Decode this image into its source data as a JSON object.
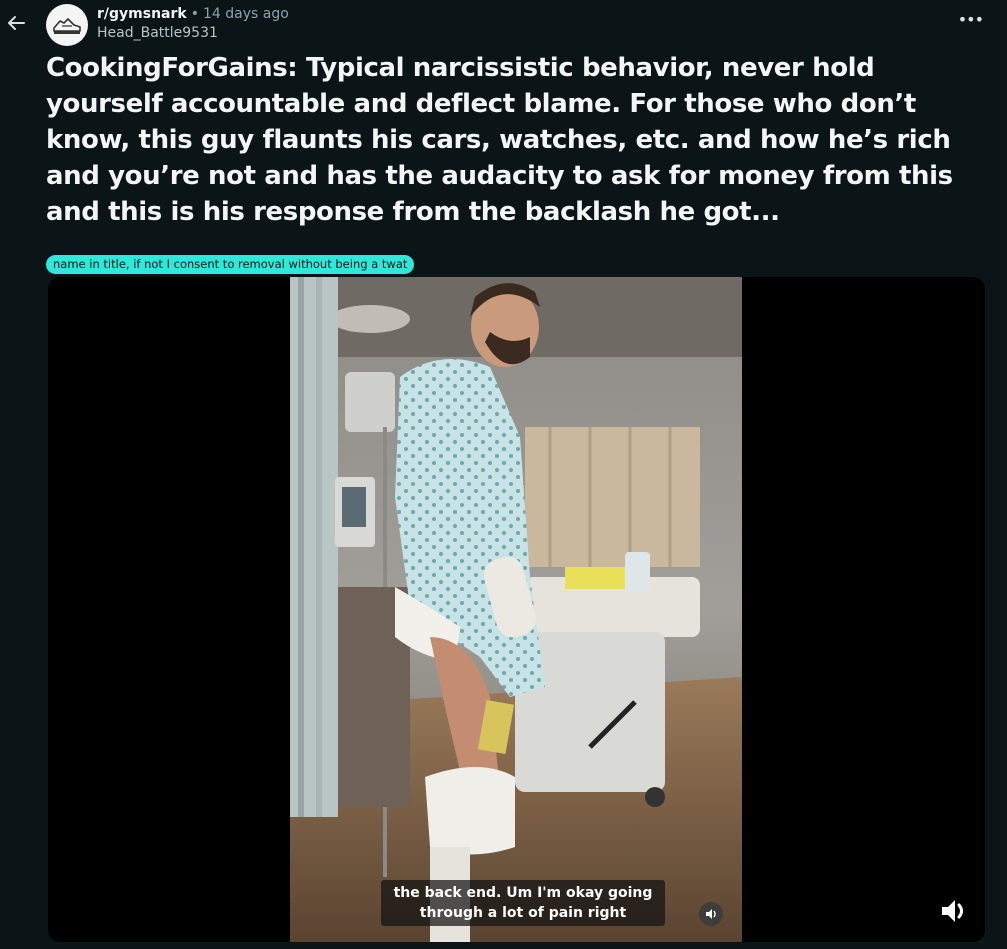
{
  "header": {
    "subreddit": "r/gymsnark",
    "separator": "•",
    "age": "14 days ago",
    "username": "Head_Battle9531",
    "more_label": "•••"
  },
  "post": {
    "title": "CookingForGains: Typical narcissistic behavior, never hold yourself accountable and deflect blame. For those who don’t know, this guy flaunts his cars, watches, etc. and how he’s rich and you’re not and has the audacity to ask for money from this and this is his response from the backlash he got...",
    "flair": "name in title, if not I consent to removal without being a twat",
    "flair_color": "#2ee8da"
  },
  "video": {
    "caption_line1": "the back end. Um I'm okay going",
    "caption_line2": "through a lot of pain right",
    "audio_state": "unmuted"
  },
  "icons": {
    "back": "arrow-left-icon",
    "avatar": "shoe-logo-icon",
    "more": "ellipsis-icon",
    "speaker_small": "speaker-icon",
    "speaker_large": "speaker-icon"
  },
  "colors": {
    "background": "#0b1416",
    "text": "#f3f5f6",
    "muted": "#8ba2ad",
    "accent": "#2ee8da"
  }
}
